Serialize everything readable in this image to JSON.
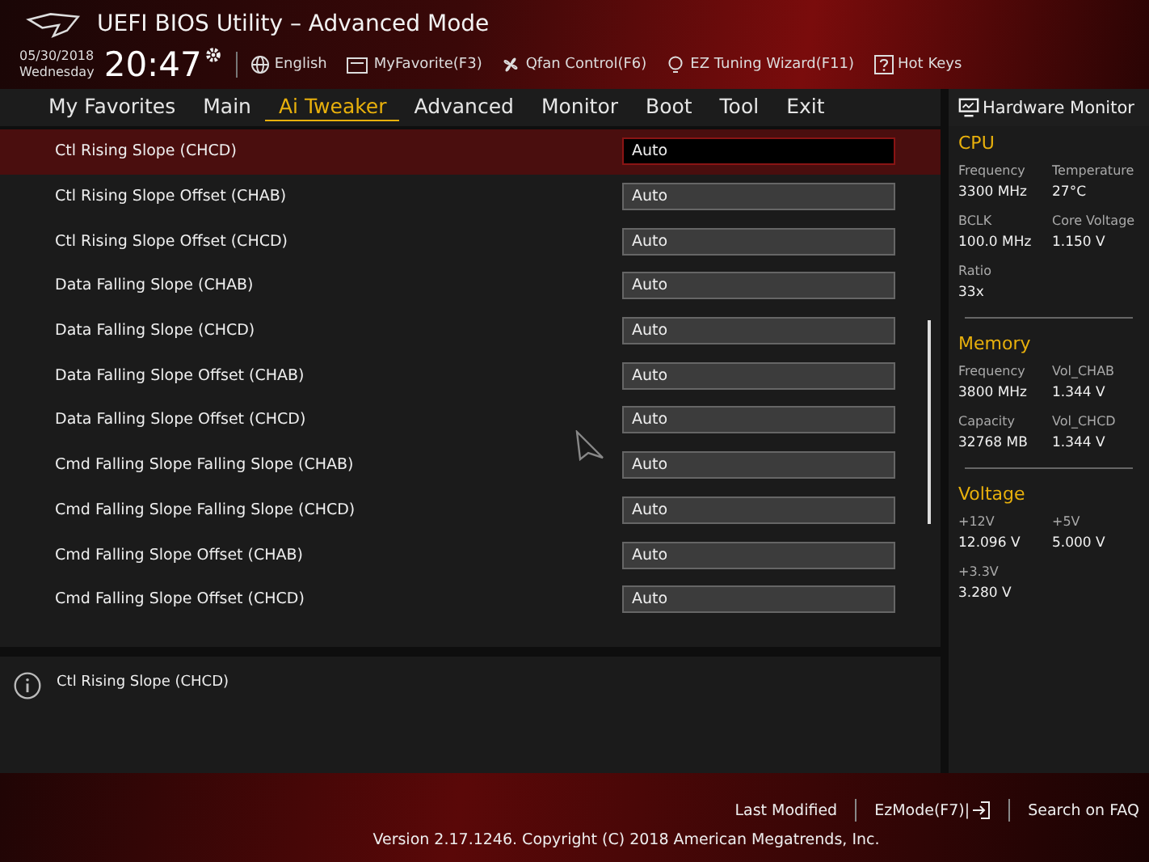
{
  "header": {
    "title": "UEFI BIOS Utility – Advanced Mode",
    "date": "05/30/2018",
    "weekday": "Wednesday",
    "time": "20:47",
    "tools": [
      {
        "kind": "globe",
        "label": "English"
      },
      {
        "kind": "favorite",
        "label": "MyFavorite(F3)"
      },
      {
        "kind": "fan",
        "label": "Qfan Control(F6)"
      },
      {
        "kind": "bulb",
        "label": "EZ Tuning Wizard(F11)"
      },
      {
        "kind": "help",
        "label": "Hot Keys"
      }
    ]
  },
  "tabs": [
    {
      "label": "My Favorites",
      "selected": false
    },
    {
      "label": "Main",
      "selected": false
    },
    {
      "label": "Ai Tweaker",
      "selected": true
    },
    {
      "label": "Advanced",
      "selected": false
    },
    {
      "label": "Monitor",
      "selected": false
    },
    {
      "label": "Boot",
      "selected": false
    },
    {
      "label": "Tool",
      "selected": false
    },
    {
      "label": "Exit",
      "selected": false
    }
  ],
  "settings": [
    {
      "label": "Ctl Rising Slope (CHCD)",
      "value": "Auto",
      "selected": true
    },
    {
      "label": "Ctl Rising Slope Offset (CHAB)",
      "value": "Auto",
      "selected": false
    },
    {
      "label": "Ctl Rising Slope Offset (CHCD)",
      "value": "Auto",
      "selected": false
    },
    {
      "label": "Data Falling Slope (CHAB)",
      "value": "Auto",
      "selected": false
    },
    {
      "label": "Data Falling Slope (CHCD)",
      "value": "Auto",
      "selected": false
    },
    {
      "label": "Data Falling Slope Offset (CHAB)",
      "value": "Auto",
      "selected": false
    },
    {
      "label": "Data Falling Slope Offset (CHCD)",
      "value": "Auto",
      "selected": false
    },
    {
      "label": "Cmd Falling Slope Falling Slope (CHAB)",
      "value": "Auto",
      "selected": false
    },
    {
      "label": "Cmd Falling Slope Falling Slope (CHCD)",
      "value": "Auto",
      "selected": false
    },
    {
      "label": "Cmd Falling Slope Offset (CHAB)",
      "value": "Auto",
      "selected": false
    },
    {
      "label": "Cmd Falling Slope Offset (CHCD)",
      "value": "Auto",
      "selected": false
    }
  ],
  "help": {
    "text": "Ctl Rising Slope (CHCD)"
  },
  "hardware_monitor": {
    "title": "Hardware Monitor",
    "sections": [
      {
        "title": "CPU",
        "items": [
          {
            "label": "Frequency",
            "value": "3300 MHz"
          },
          {
            "label": "Temperature",
            "value": "27°C"
          },
          {
            "label": "BCLK",
            "value": "100.0 MHz"
          },
          {
            "label": "Core Voltage",
            "value": "1.150 V"
          },
          {
            "label": "Ratio",
            "value": "33x"
          }
        ]
      },
      {
        "title": "Memory",
        "items": [
          {
            "label": "Frequency",
            "value": "3800 MHz"
          },
          {
            "label": "Vol_CHAB",
            "value": "1.344 V"
          },
          {
            "label": "Capacity",
            "value": "32768 MB"
          },
          {
            "label": "Vol_CHCD",
            "value": "1.344 V"
          }
        ]
      },
      {
        "title": "Voltage",
        "items": [
          {
            "label": "+12V",
            "value": "12.096 V"
          },
          {
            "label": "+5V",
            "value": "5.000 V"
          },
          {
            "label": "+3.3V",
            "value": "3.280 V"
          }
        ]
      }
    ]
  },
  "footer": {
    "links": [
      {
        "kind": "text",
        "label": "Last Modified"
      },
      {
        "kind": "exit",
        "label": "EzMode(F7)|"
      },
      {
        "kind": "text",
        "label": "Search on FAQ"
      }
    ],
    "version": "Version 2.17.1246. Copyright (C) 2018 American Megatrends, Inc."
  }
}
